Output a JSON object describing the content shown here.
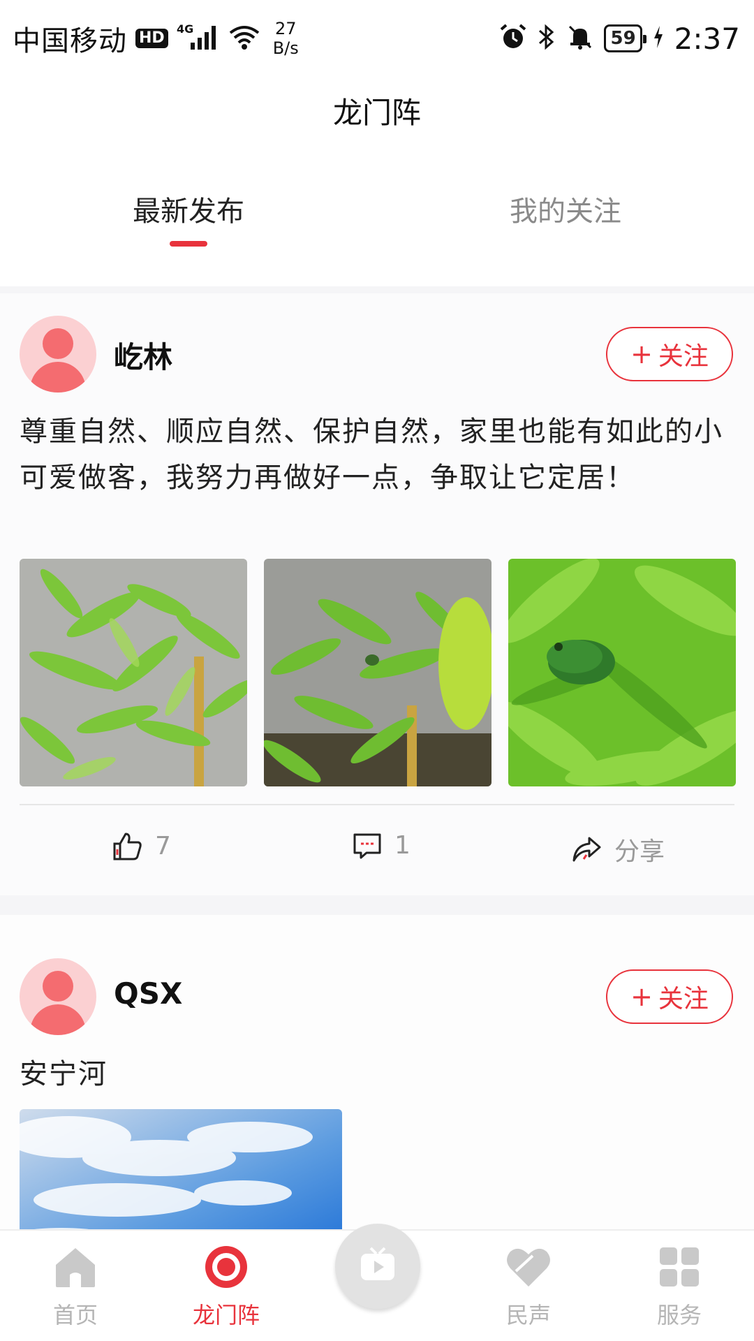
{
  "status_bar": {
    "carrier": "中国移动",
    "hd": "HD",
    "network": "4G",
    "rate_value": "27",
    "rate_unit": "B/s",
    "battery": "59",
    "time": "2:37",
    "icons": [
      "hd-icon",
      "signal-icon",
      "wifi-icon",
      "alarm-icon",
      "bluetooth-icon",
      "mute-icon",
      "battery-icon",
      "charging-icon"
    ]
  },
  "header": {
    "title": "龙门阵",
    "tabs": [
      {
        "label": "最新发布",
        "active": true
      },
      {
        "label": "我的关注",
        "active": false
      }
    ]
  },
  "posts": [
    {
      "user": "屹林",
      "follow_label": "关注",
      "follow_plus": "+",
      "text": "尊重自然、顺应自然、保护自然，家里也能有如此的小可爱做客，我努力再做好一点，争取让它定居！",
      "likes": "7",
      "comments": "1",
      "share_label": "分享"
    },
    {
      "user": "QSX",
      "follow_label": "关注",
      "follow_plus": "+",
      "text": "安宁河"
    }
  ],
  "bottom_nav": {
    "items": [
      {
        "label": "首页",
        "icon": "home-icon",
        "active": false
      },
      {
        "label": "龙门阵",
        "icon": "target-icon",
        "active": true
      },
      {
        "label": "",
        "icon": "tv-play-icon",
        "active": false
      },
      {
        "label": "民声",
        "icon": "heart-icon",
        "active": false
      },
      {
        "label": "服务",
        "icon": "grid-icon",
        "active": false
      }
    ]
  },
  "colors": {
    "accent": "#e8333c",
    "inactive": "#b5b5b5",
    "avatar_bg": "#fbd0d2",
    "avatar_fg": "#f46c70"
  }
}
